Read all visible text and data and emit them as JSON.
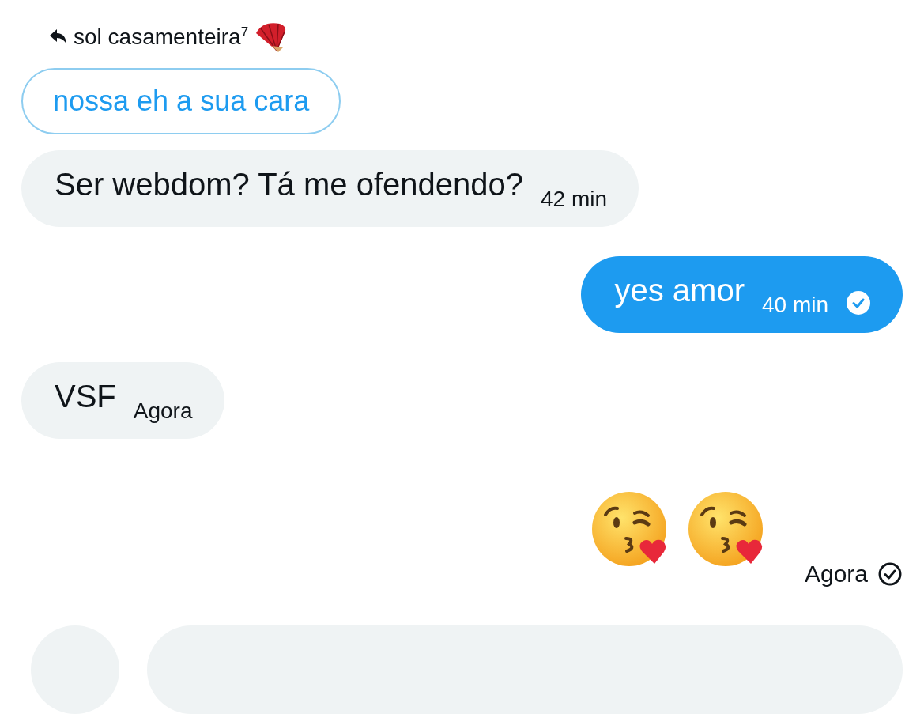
{
  "reply_header": {
    "name": "sol casamenteira$^{7}$"
  },
  "quoted_message": {
    "text": "nossa eh a sua cara"
  },
  "messages": [
    {
      "kind": "received",
      "text": "Ser webdom? Tá me ofendendo?",
      "time": "42 min"
    },
    {
      "kind": "sent",
      "text": "yes amor",
      "time": "40 min",
      "seen": true
    },
    {
      "kind": "received",
      "text": "VSF",
      "time": "Agora"
    },
    {
      "kind": "emoji",
      "emojis": [
        {
          "kind": "kissing-face"
        },
        {
          "kind": "kissing-face"
        }
      ],
      "time": "Agora",
      "seen": false
    }
  ],
  "composer": {
    "kind": "partial"
  }
}
